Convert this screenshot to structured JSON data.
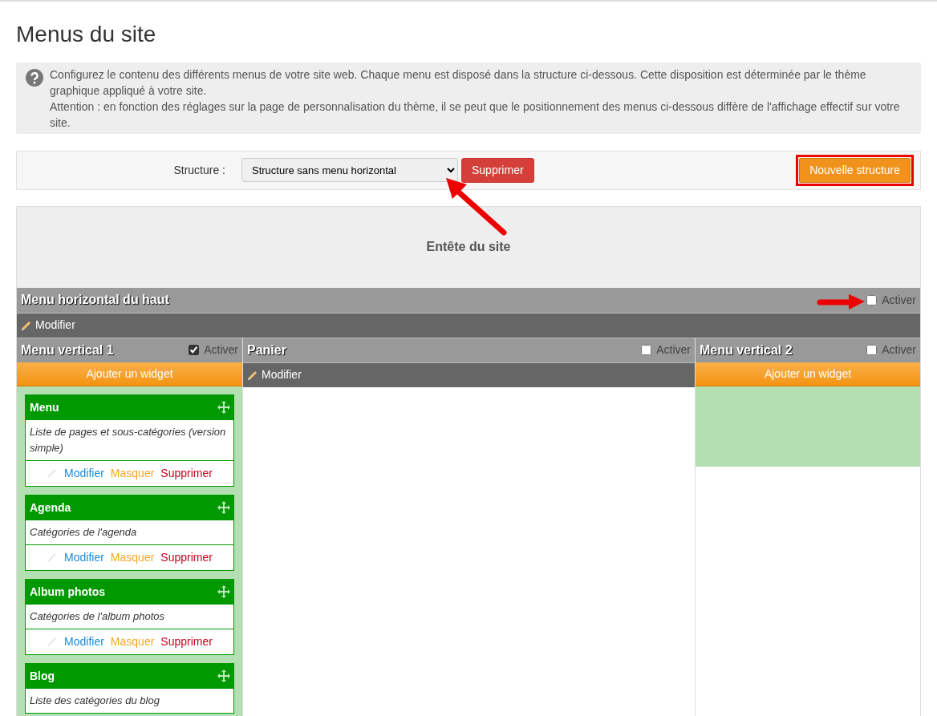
{
  "page_title": "Menus du site",
  "info": {
    "lines": [
      "Configurez le contenu des différents menus de votre site web. Chaque menu est disposé dans la structure ci-dessous. Cette disposition est déterminée par le thème graphique appliqué à votre site.",
      "Attention : en fonction des réglages sur la page de personnalisation du thème, il se peut que le positionnement des menus ci-dessous diffère de l'affichage effectif sur votre site."
    ]
  },
  "toolbar": {
    "label": "Structure :",
    "select_value": "Structure sans menu horizontal",
    "delete_button": "Supprimer",
    "new_button": "Nouvelle structure"
  },
  "site_header": "Entête du site",
  "horizontal_menu": {
    "title": "Menu horizontal du haut",
    "active": false,
    "active_label": "Activer",
    "action": {
      "kind": "modify",
      "label": "Modifier"
    }
  },
  "columns": [
    {
      "title": "Menu vertical 1",
      "active": true,
      "active_label": "Activer",
      "action": {
        "kind": "add_widget",
        "label": "Ajouter un widget"
      },
      "widgets": [
        {
          "title": "Menu",
          "description": "Liste de pages et sous-catégories (version simple)",
          "links": [
            "Modifier",
            "Masquer",
            "Supprimer"
          ]
        },
        {
          "title": "Agenda",
          "description": "Catégories de l'agenda",
          "links": [
            "Modifier",
            "Masquer",
            "Supprimer"
          ]
        },
        {
          "title": "Album photos",
          "description": "Catégories de l'album photos",
          "links": [
            "Modifier",
            "Masquer",
            "Supprimer"
          ]
        },
        {
          "title": "Blog",
          "description": "Liste des catégories du blog"
        }
      ]
    },
    {
      "title": "Panier",
      "active": false,
      "active_label": "Activer",
      "action": {
        "kind": "modify",
        "label": "Modifier"
      }
    },
    {
      "title": "Menu vertical 2",
      "active": false,
      "active_label": "Activer",
      "action": {
        "kind": "add_widget",
        "label": "Ajouter un widget"
      }
    }
  ]
}
